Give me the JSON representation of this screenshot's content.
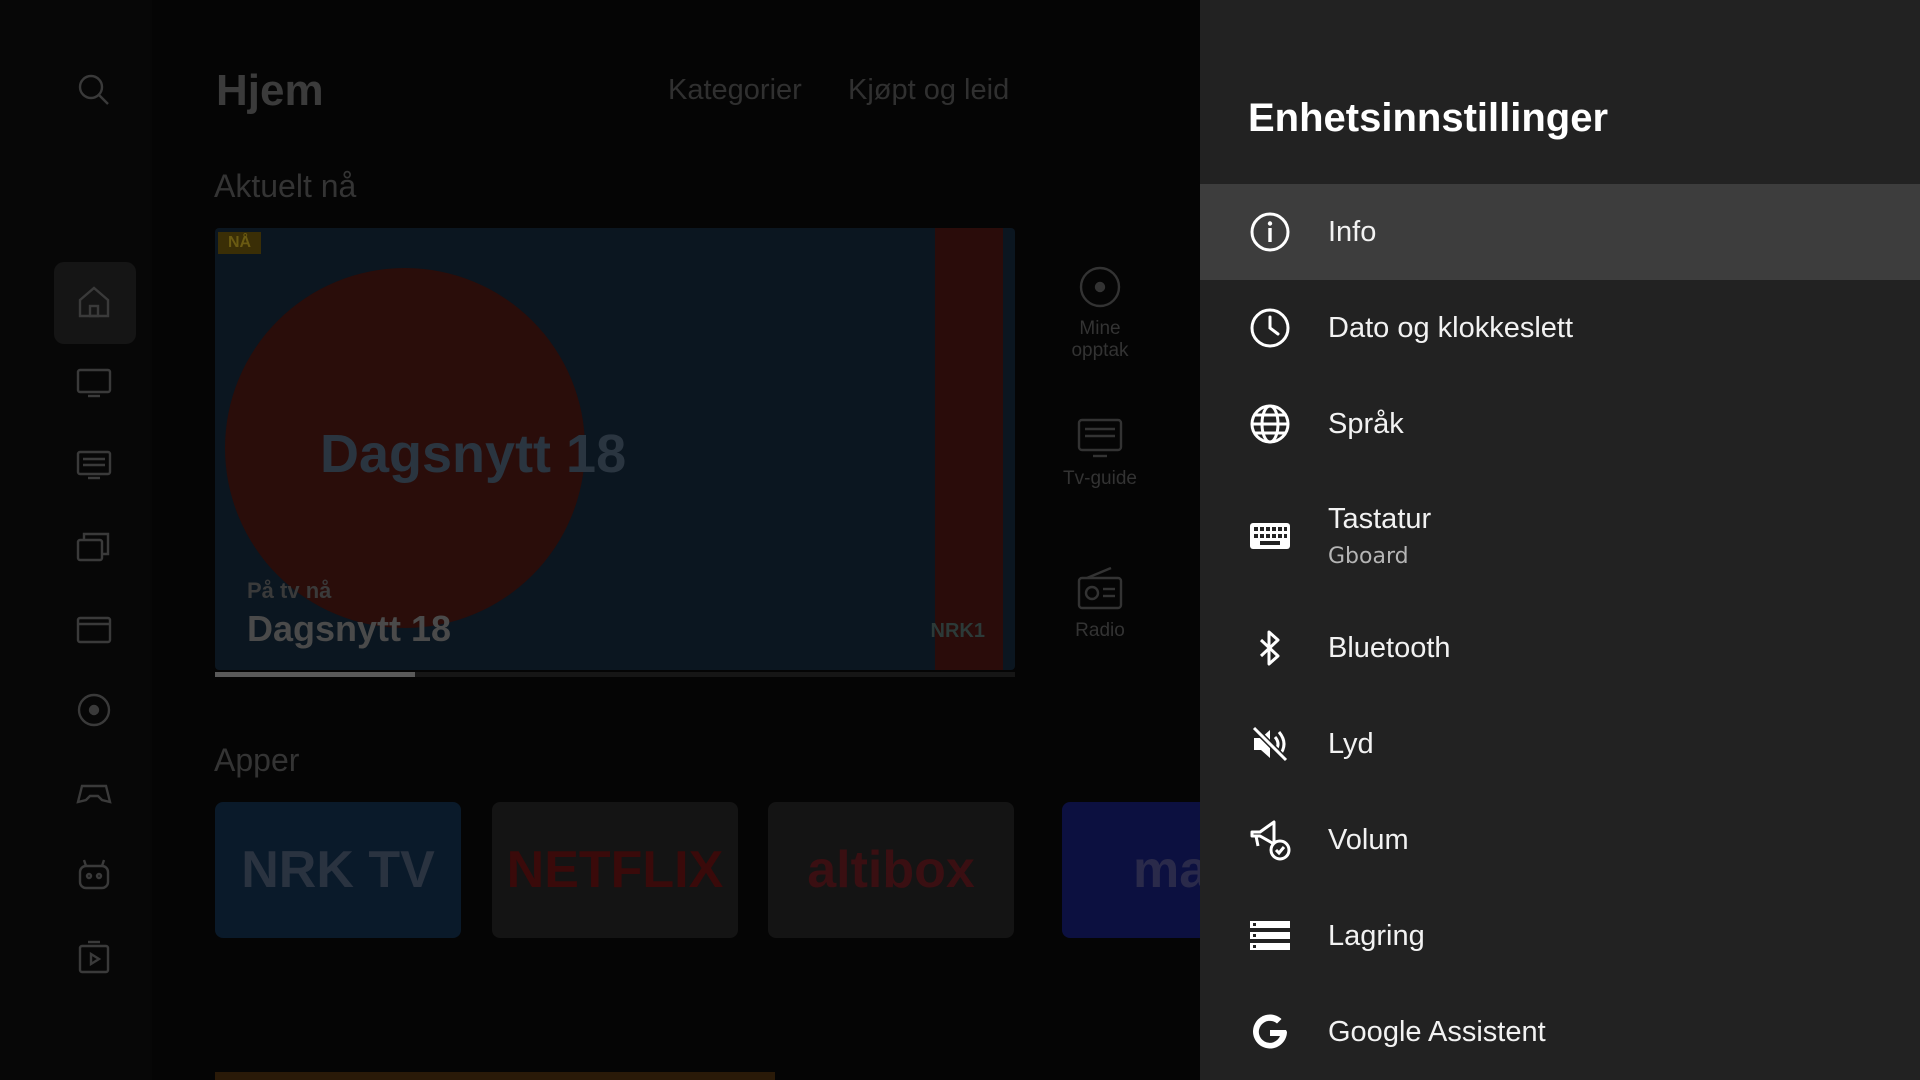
{
  "background": {
    "nav_icons": [
      "search-icon",
      "home-icon",
      "tv-icon",
      "guide-icon",
      "library-icon",
      "movie-icon",
      "record-icon",
      "game-icon",
      "kids-icon",
      "apps-icon"
    ],
    "page_title": "Hjem",
    "tabs": [
      "Kategorier",
      "Kjøpt og leid"
    ],
    "section_current": "Aktuelt nå",
    "hero": {
      "badge": "NÅ",
      "show_graphic": "Dagsnytt 18",
      "on_tv_label": "På tv nå",
      "title": "Dagsnytt 18",
      "channel_logo": "NRK1",
      "progress": 0.25
    },
    "side_tiles": [
      {
        "label_line1": "Mine",
        "label_line2": "opptak",
        "icon": "record-icon"
      },
      {
        "label_line1": "Tv-guide",
        "label_line2": "",
        "icon": "guide-icon"
      },
      {
        "label_line1": "Radio",
        "label_line2": "",
        "icon": "radio-icon"
      }
    ],
    "section_apps": "Apper",
    "apps": [
      {
        "label": "NRK TV",
        "color": "#0a1a2a",
        "text_color": "#2a3340"
      },
      {
        "label": "NETFLIX",
        "color": "#141414",
        "text_color": "#3a0a0a"
      },
      {
        "label": "altibox",
        "color": "#141414",
        "text_color": "#3a0f12"
      },
      {
        "label": "max",
        "color": "#0c1040",
        "text_color": "#2a2a4a"
      }
    ]
  },
  "panel": {
    "title": "Enhetsinnstillinger",
    "items": [
      {
        "label": "Info",
        "sublabel": "",
        "icon": "info-icon",
        "selected": true
      },
      {
        "label": "Dato og klokkeslett",
        "sublabel": "",
        "icon": "clock-icon",
        "selected": false
      },
      {
        "label": "Språk",
        "sublabel": "",
        "icon": "globe-icon",
        "selected": false
      },
      {
        "label": "Tastatur",
        "sublabel": "Gboard",
        "icon": "keyboard-icon",
        "selected": false
      },
      {
        "label": "Bluetooth",
        "sublabel": "",
        "icon": "bluetooth-icon",
        "selected": false
      },
      {
        "label": "Lyd",
        "sublabel": "",
        "icon": "sound-off-icon",
        "selected": false
      },
      {
        "label": "Volum",
        "sublabel": "",
        "icon": "volume-check-icon",
        "selected": false
      },
      {
        "label": "Lagring",
        "sublabel": "",
        "icon": "storage-icon",
        "selected": false
      },
      {
        "label": "Google Assistent",
        "sublabel": "",
        "icon": "google-icon",
        "selected": false
      }
    ]
  }
}
